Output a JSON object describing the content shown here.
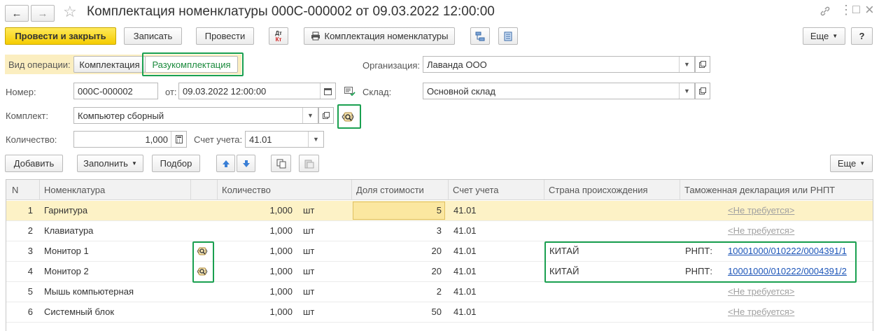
{
  "window": {
    "title": "Комплектация номенклатуры 000С-000002 от 09.03.2022 12:00:00",
    "nav_back": "←",
    "nav_forward": "→",
    "star": "☆",
    "link_icon": "link-icon",
    "menu_icon": "⋮",
    "maximize_icon": "□",
    "close_icon": "×"
  },
  "toolbar": {
    "post_close": "Провести и закрыть",
    "write": "Записать",
    "post": "Провести",
    "dt_kt_top": "Дт",
    "dt_kt_bottom": "Кт",
    "print_label": "Комплектация номенклатуры",
    "more": "Еще",
    "help": "?"
  },
  "form": {
    "operation_label": "Вид операции:",
    "op_assembly": "Комплектация",
    "op_disassembly": "Разукомплектация",
    "org_label": "Организация:",
    "org_value": "Лаванда ООО",
    "number_label": "Номер:",
    "number_value": "000С-000002",
    "date_label": "от:",
    "date_value": "09.03.2022 12:00:00",
    "warehouse_label": "Склад:",
    "warehouse_value": "Основной склад",
    "kit_label": "Комплект:",
    "kit_value": "Компьютер сборный",
    "qty_label": "Количество:",
    "qty_value": "1,000",
    "account_label": "Счет учета:",
    "account_value": "41.01"
  },
  "table_toolbar": {
    "add": "Добавить",
    "fill": "Заполнить",
    "select": "Подбор",
    "more": "Еще"
  },
  "table": {
    "headers": [
      "N",
      "Номенклатура",
      "",
      "Количество",
      "Доля стоимости",
      "Счет учета",
      "Страна происхождения",
      "Таможенная декларация или РНПТ"
    ],
    "rows": [
      {
        "n": "1",
        "name": "Гарнитура",
        "icon": false,
        "qty": "1,000",
        "unit": "шт",
        "share": "5",
        "account": "41.01",
        "country": "",
        "rnpt_label": "",
        "decl": "<Не требуется>",
        "decl_na": true
      },
      {
        "n": "2",
        "name": "Клавиатура",
        "icon": false,
        "qty": "1,000",
        "unit": "шт",
        "share": "3",
        "account": "41.01",
        "country": "",
        "rnpt_label": "",
        "decl": "<Не требуется>",
        "decl_na": true
      },
      {
        "n": "3",
        "name": "Монитор 1",
        "icon": true,
        "qty": "1,000",
        "unit": "шт",
        "share": "20",
        "account": "41.01",
        "country": "КИТАЙ",
        "rnpt_label": "РНПТ:",
        "decl": "10001000/010222/0004391/1",
        "decl_na": false
      },
      {
        "n": "4",
        "name": "Монитор 2",
        "icon": true,
        "qty": "1,000",
        "unit": "шт",
        "share": "20",
        "account": "41.01",
        "country": "КИТАЙ",
        "rnpt_label": "РНПТ:",
        "decl": "10001000/010222/0004391/2",
        "decl_na": false
      },
      {
        "n": "5",
        "name": "Мышь компьютерная",
        "icon": false,
        "qty": "1,000",
        "unit": "шт",
        "share": "2",
        "account": "41.01",
        "country": "",
        "rnpt_label": "",
        "decl": "<Не требуется>",
        "decl_na": true
      },
      {
        "n": "6",
        "name": "Системный блок",
        "icon": false,
        "qty": "1,000",
        "unit": "шт",
        "share": "50",
        "account": "41.01",
        "country": "",
        "rnpt_label": "",
        "decl": "<Не требуется>",
        "decl_na": true
      }
    ]
  },
  "colors": {
    "primary_button": "#f5cc00",
    "highlight_frame": "#1aa050",
    "selected_row": "#fdf2c6",
    "link": "#1c55b8"
  }
}
